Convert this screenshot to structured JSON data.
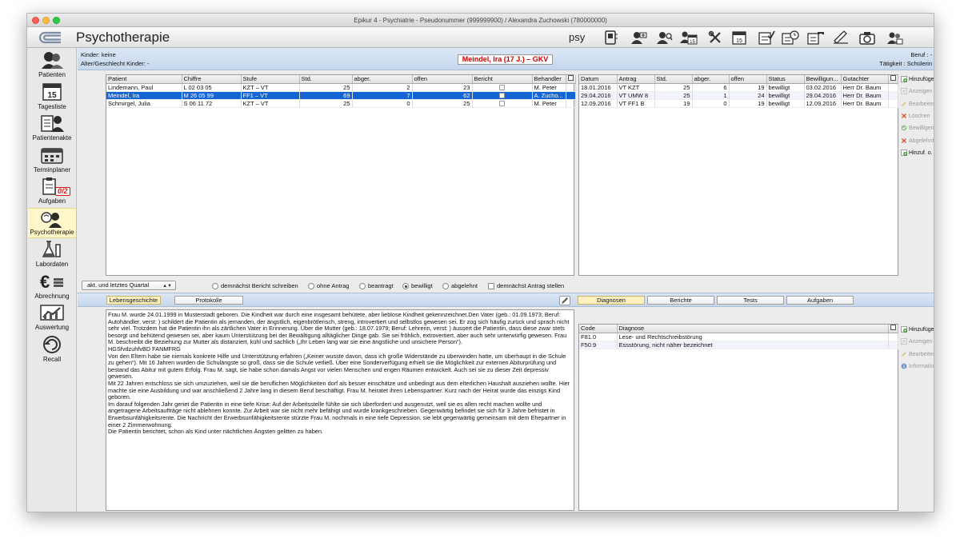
{
  "window": {
    "title": "Epikur 4 - Psychiatrie - Pseudonummer (999999900) / Alexandra Zuchowski (780000000)"
  },
  "header": {
    "title": "Psychotherapie",
    "mode": "psy",
    "tool_icons": [
      "phone-book-icon",
      "patient-add-icon",
      "patient-search-icon",
      "calendar-patient-icon",
      "tools-icon",
      "calendar-15-icon",
      "checklist-icon",
      "clock-list-icon",
      "phone-list-icon",
      "sign-icon",
      "camera-icon",
      "users-icon"
    ]
  },
  "sidebar": {
    "items": [
      {
        "label": "Patienten",
        "icon": "patients-icon"
      },
      {
        "label": "Tagesliste",
        "icon": "day-list-icon"
      },
      {
        "label": "Patientenakte",
        "icon": "patient-file-icon"
      },
      {
        "label": "Terminplaner",
        "icon": "scheduler-icon"
      },
      {
        "label": "Aufgaben",
        "icon": "tasks-icon",
        "badge": "0/2"
      },
      {
        "label": "Psychotherapie",
        "icon": "psychotherapy-icon",
        "active": true
      },
      {
        "label": "Labordaten",
        "icon": "lab-icon"
      },
      {
        "label": "Abrechnung",
        "icon": "billing-icon"
      },
      {
        "label": "Auswertung",
        "icon": "analysis-icon"
      },
      {
        "label": "Recall",
        "icon": "recall-icon"
      }
    ]
  },
  "infobar": {
    "kinder": "Kinder: keine",
    "alter": "Alter/Geschlecht Kinder:  -",
    "patient_chip": "Meindel, Ira (17 J.) – GKV",
    "beruf": "Beruf :  -",
    "taetigkeit": "Tätigkeit : Schülerin"
  },
  "patients_table": {
    "columns": [
      "Patient",
      "Chiffre",
      "Stufe",
      "Std.",
      "abger.",
      "offen",
      "Bericht",
      "Behandler"
    ],
    "rows": [
      {
        "patient": "Lindemann, Paul",
        "chiffre": "L 02 03 05",
        "stufe": "KZT – VT",
        "std": "25",
        "abger": "2",
        "offen": "23",
        "bericht": false,
        "behandler": "M. Peter"
      },
      {
        "patient": "Meindel, Ira",
        "chiffre": "M 26 05 99",
        "stufe": "FF1 – VT",
        "std": "69",
        "abger": "7",
        "offen": "62",
        "bericht": false,
        "behandler": "A. Zucho...",
        "selected": true
      },
      {
        "patient": "Schmirgel, Julia",
        "chiffre": "S 06 11 72",
        "stufe": "KZT – VT",
        "std": "25",
        "abger": "0",
        "offen": "25",
        "bericht": false,
        "behandler": "M. Peter"
      }
    ]
  },
  "applications_table": {
    "columns": [
      "Datum",
      "Antrag",
      "Std.",
      "abger.",
      "offen",
      "Status",
      "Bewilligun...",
      "Gutachter"
    ],
    "rows": [
      {
        "datum": "18.01.2016",
        "antrag": "VT KZT",
        "std": "25",
        "abger": "6",
        "offen": "19",
        "status": "bewilligt",
        "bewilligung": "03.02.2016",
        "gutachter": "Herr Dr. Baum"
      },
      {
        "datum": "29.04.2016",
        "antrag": "VT UMW 8",
        "std": "25",
        "abger": "1",
        "offen": "24",
        "status": "bewilligt",
        "bewilligung": "29.04.2016",
        "gutachter": "Herr Dr. Baum"
      },
      {
        "datum": "12.09.2016",
        "antrag": "VT FF1 B",
        "std": "19",
        "abger": "0",
        "offen": "19",
        "status": "bewilligt",
        "bewilligung": "12.09.2016",
        "gutachter": "Herr Dr. Baum"
      }
    ]
  },
  "top_actions": [
    {
      "label": "Hinzufügen",
      "enabled": true,
      "icon": "add-icon"
    },
    {
      "label": "Anzeigen",
      "enabled": false,
      "icon": "view-icon"
    },
    {
      "label": "Bearbeiten",
      "enabled": false,
      "icon": "edit-icon"
    },
    {
      "label": "Löschen",
      "enabled": false,
      "icon": "delete-icon"
    },
    {
      "label": "Bewilligen",
      "enabled": false,
      "icon": "approve-icon"
    },
    {
      "label": "Abgelehnt",
      "enabled": false,
      "icon": "reject-icon"
    },
    {
      "label": "Hinzuf. o. Ausdruck",
      "enabled": true,
      "icon": "add-noprint-icon"
    }
  ],
  "filter": {
    "combo_value": "akt. und letztes Quartal",
    "radios": [
      {
        "label": "demnächst Bericht schreiben",
        "checked": false
      },
      {
        "label": "ohne Antrag",
        "checked": false
      },
      {
        "label": "beantragt",
        "checked": false
      },
      {
        "label": "bewilligt",
        "checked": true
      },
      {
        "label": "abgelehnt",
        "checked": false
      }
    ],
    "checkbox_label": "demnächst Antrag stellen"
  },
  "left_tabs": [
    "Lebensgeschichte",
    "Protokolle"
  ],
  "right_tabs": [
    "Diagnosen",
    "Berichte",
    "Tests",
    "Aufgaben"
  ],
  "life_history": [
    "Frau M. wurde 24.01.1999 in Musterstadt geboren. Die Kindheit war durch eine insgesamt behütete, aber lieblose Kindheit gekennzeichnet.Den Vater (geb.: 01.09.1973; Beruf: Autohändler, verst: ) schildert die Patientin als jemanden, der ängstlich, eigenbrötlerisch, streng, introvertiert und selbstlos gewesen sei. Er zog sich häufig zurück und sprach nicht sehr viel. Trotzdem hat die Patientin ihn als zärtlichen Vater in Erinnerung. Über die Mutter (geb.: 18.07.1979; Beruf: Lehrerin, verst: ) äussert die Patientin, dass diese zwar stets besorgt und behütend gewesen sei, aber kaum Unterstützung bei der Bewältigung alltäglicher Dinge gab. Sie sei fröhlich, extrovertiert, aber auch sehr unterwürfig gewesen. Frau M. beschreibt die Beziehung zur Mutter als distanziert, kühl und sachlich („Ihr Leben lang war sie eine ängstliche und unsichere Person“).",
    "HGSfvdzuhfvBD FANMFRG",
    "Von den Eltern habe sie niemals konkrete Hilfe und Unterstützung erfahren („Keiner wusste davon, dass ich große Widerstände zu überwinden hatte, um überhaupt in die Schule zu gehen“). Mit 16 Jahren wurden die Schulängste so groß, dass sie die Schule verließ. Über eine Sonderverfügung erhielt sie die Möglichkeit zur externen Abiturprüfung und bestand das Abitur mit gutem Erfolg. Frau M. sagt, sie habe schon damals Angst vor vielen Menschen und engen Räumen entwickelt. Auch sei sie zu dieser Zeit depressiv gewesen.",
    "Mit 22 Jahren entschloss sie sich umzuziehen, weil sie die beruflichen Möglichkeiten dorf als besser einschätze und unbedingt aus dem elterlichen Haushalt ausziehen wollte. Hier machte sie eine Ausbildung und war anschließend 2 Jahre lang in diesem Beruf beschäftigt. Frau M. heiratet ihren Lebenspartner. Kurz nach der Heirat wurde das einzigs Kind geboren.",
    "Im darauf folgenden Jahr geriet die Patientin in eine tiefe Krise: Auf der Arbeitsstelle fühlte sie sich überfordert und ausgenutzt, weil sie es allen recht machen wollte und angetragene Arbeitsaufträge nicht ablehnen konnte. Zur Arbeit war sie nicht mehr befähigt und wurde krankgeschrieben. Gegenwärtig befindet sie sich für 3 Jahre befristet in Erwerbsunfähigkeitsrente. Die Nachricht der Erwerbsunfähigkeitsrente stürzte Frau M. nochmals in eine tiefe Depression. sie lebt gegenwärtig gemeinsam mit dem Ehepartner in einer 2 Zimmerwohnung.",
    "Die Patientin berichtet, schon als Kind unter nächtlichen Ängsten gelitten zu haben."
  ],
  "diagnoses_table": {
    "columns": [
      "Code",
      "Diagnose"
    ],
    "rows": [
      {
        "code": "F81.0",
        "diagnose": "Lese- und Rechtschreibstörung"
      },
      {
        "code": "F50.9",
        "diagnose": "Essstörung, nicht näher bezeichnet"
      }
    ]
  },
  "bottom_actions": [
    {
      "label": "Hinzufügen",
      "enabled": true,
      "icon": "add-icon"
    },
    {
      "label": "Anzeigen",
      "enabled": false,
      "icon": "view-icon"
    },
    {
      "label": "Bearbeiten",
      "enabled": false,
      "icon": "edit-icon"
    },
    {
      "label": "Information",
      "enabled": false,
      "icon": "info-icon"
    }
  ],
  "colors": {
    "selection": "#1464d4",
    "patient_chip_text": "#cc0000",
    "active_nav": "#fff7c9",
    "infobar": "#c6d7ec",
    "add_icon": "#3a9a2a",
    "delete_icon": "#e0522d"
  }
}
